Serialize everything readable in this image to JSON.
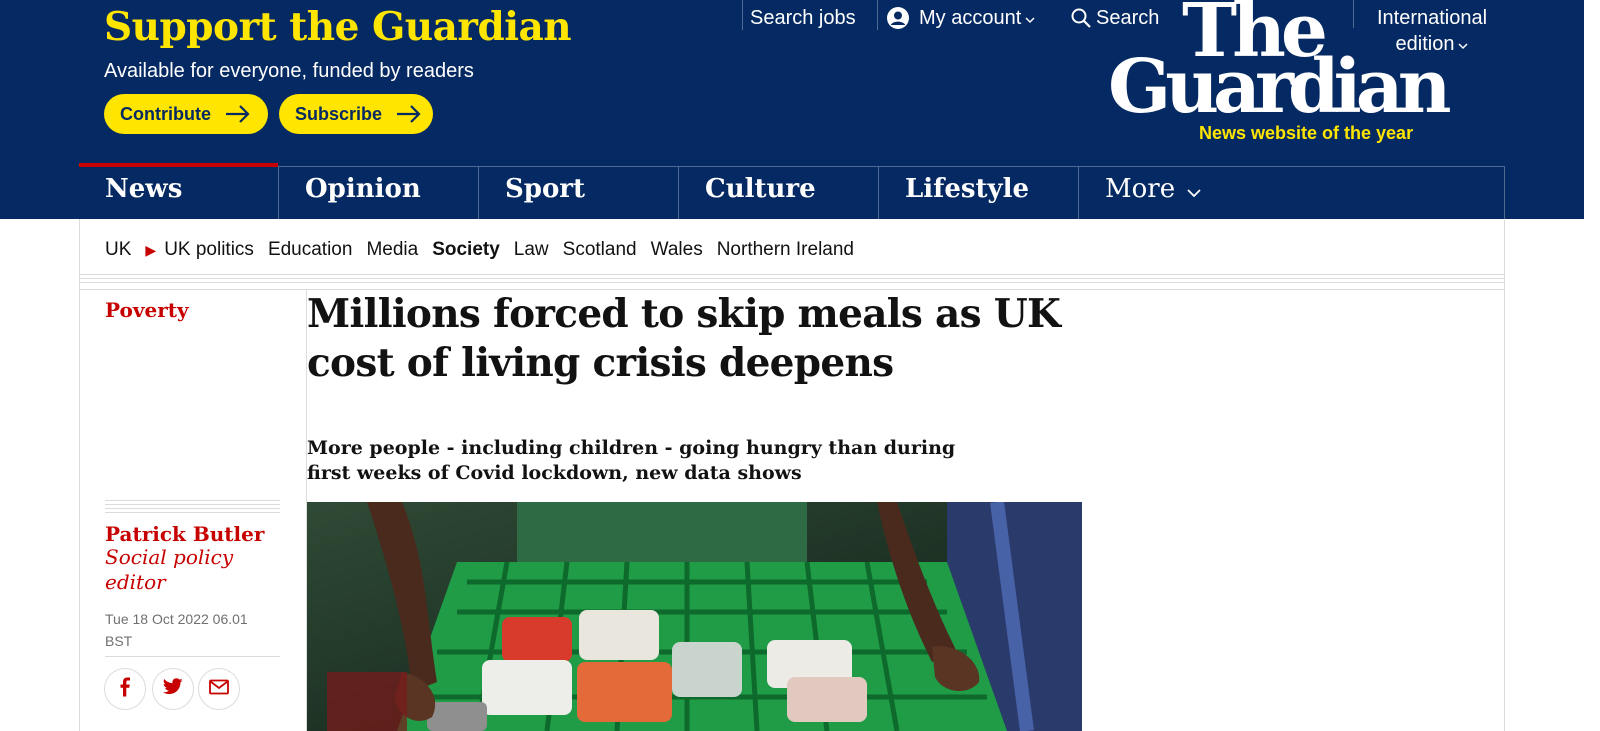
{
  "support": {
    "title": "Support the Guardian",
    "subtitle": "Available for everyone, funded by readers",
    "contribute_label": "Contribute",
    "subscribe_label": "Subscribe"
  },
  "toplinks": {
    "jobs": "Search jobs",
    "account": "My account",
    "search": "Search",
    "edition_line1": "International",
    "edition_line2": "edition"
  },
  "logo": {
    "line1": "The",
    "line2": "Guardian",
    "tagline": "News website of the year"
  },
  "pillars": [
    "News",
    "Opinion",
    "Sport",
    "Culture",
    "Lifestyle",
    "More"
  ],
  "subnav": {
    "section": "UK",
    "items": [
      "UK politics",
      "Education",
      "Media",
      "Society",
      "Law",
      "Scotland",
      "Wales",
      "Northern Ireland"
    ]
  },
  "article": {
    "kicker": "Poverty",
    "headline": "Millions forced to skip meals as UK cost of living crisis deepens",
    "standfirst": "More people - including children - going hungry than during first weeks of Covid lockdown, new data shows",
    "author": "Patrick Butler",
    "author_role": "Social policy editor",
    "dateline": "Tue 18 Oct 2022 06.01 BST"
  },
  "colors": {
    "brand_blue": "#052962",
    "brand_yellow": "#ffe500",
    "news_red": "#c70000"
  },
  "icons": [
    "user-icon",
    "search-icon",
    "chevron-down-icon",
    "arrow-right-icon",
    "facebook-icon",
    "twitter-icon",
    "email-icon"
  ]
}
